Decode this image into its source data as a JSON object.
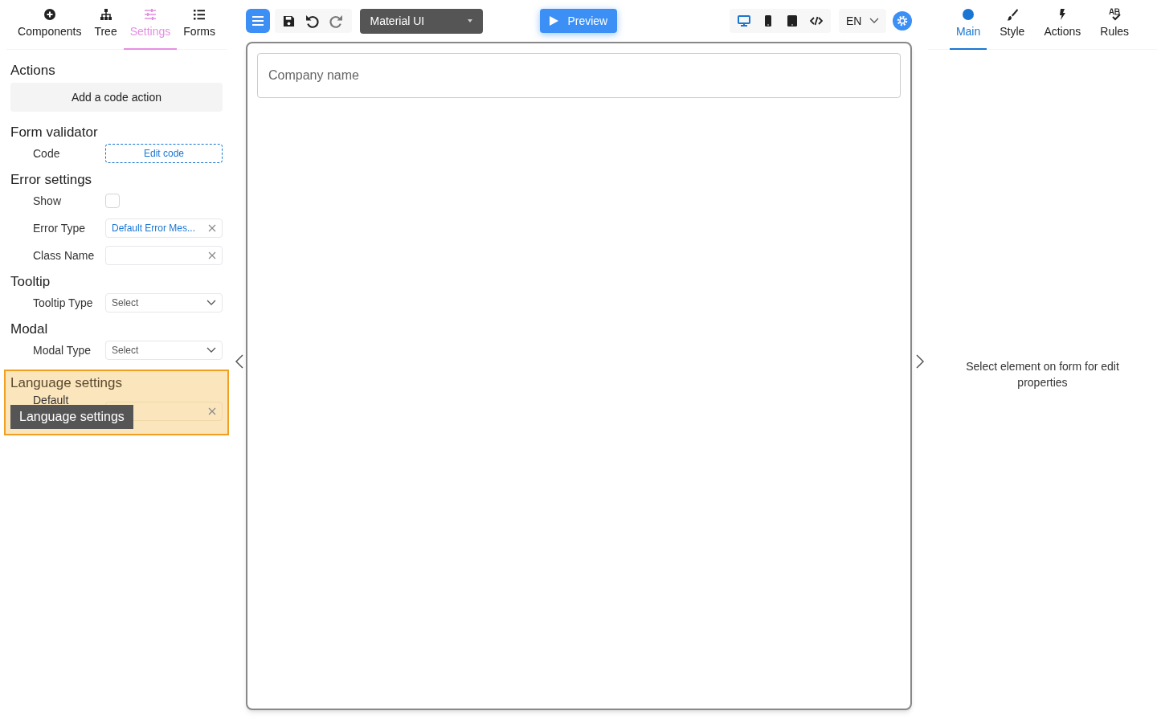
{
  "left_tabs": [
    {
      "label": "Components",
      "selected": false
    },
    {
      "label": "Tree",
      "selected": false
    },
    {
      "label": "Settings",
      "selected": true
    },
    {
      "label": "Forms",
      "selected": false
    }
  ],
  "sections": [
    {
      "title": "Actions",
      "rows": [
        {
          "kind": "button",
          "value": "Add a code action"
        }
      ]
    },
    {
      "title": "Form validator",
      "rows": [
        {
          "kind": "code",
          "label": "Code",
          "value": "Edit code"
        }
      ]
    },
    {
      "title": "Error settings",
      "rows": [
        {
          "kind": "checkbox",
          "label": "Show",
          "checked": false
        },
        {
          "kind": "tag",
          "label": "Error Type",
          "value": "Default Error Mes..."
        },
        {
          "kind": "clear",
          "label": "Class Name"
        }
      ]
    },
    {
      "title": "Tooltip",
      "rows": [
        {
          "kind": "select",
          "label": "Tooltip Type",
          "placeholder": "Select"
        }
      ]
    },
    {
      "title": "Modal",
      "rows": [
        {
          "kind": "select",
          "label": "Modal Type",
          "placeholder": "Select"
        }
      ]
    },
    {
      "title": "Language settings",
      "highlighted": true,
      "rows": [
        {
          "kind": "clear",
          "label": "Default"
        }
      ]
    }
  ],
  "tooltip": "Language settings",
  "toolbar": {
    "theme": "Material UI",
    "preview": "Preview",
    "language": "EN",
    "devices": [
      {
        "selected": true
      },
      {
        "selected": false
      },
      {
        "selected": false
      },
      {
        "selected": false
      }
    ]
  },
  "canvas": {
    "field_placeholder": "Company name"
  },
  "right_tabs": [
    {
      "label": "Main",
      "selected": true
    },
    {
      "label": "Style",
      "selected": false
    },
    {
      "label": "Actions",
      "selected": false
    },
    {
      "label": "Rules",
      "selected": false
    }
  ],
  "right_message": "Select element on form for edit properties"
}
